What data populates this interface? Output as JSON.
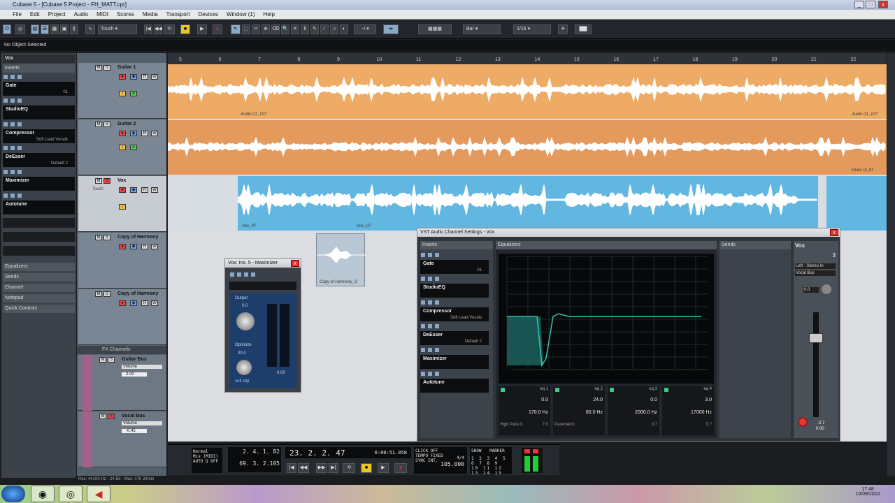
{
  "window": {
    "title": "Cubase 5 - [Cubase 5 Project - FH_MATT.cpr]"
  },
  "menu": [
    "File",
    "Edit",
    "Project",
    "Audio",
    "MIDI",
    "Scores",
    "Media",
    "Transport",
    "Devices",
    "Window (1)",
    "Help"
  ],
  "toolbar": {
    "automation_mode": "Touch",
    "snap_type": "Bar",
    "quantize": "1/16"
  },
  "info_line": "No Object Selected",
  "inspector": {
    "track_name": "Vox",
    "inserts_label": "Inserts",
    "inserts": [
      {
        "name": "Gate",
        "preset": "01"
      },
      {
        "name": "StudioEQ",
        "preset": ""
      },
      {
        "name": "Compressor",
        "preset": "Soft Lead Vocals"
      },
      {
        "name": "DeEsser",
        "preset": "Default 2"
      },
      {
        "name": "Maximizer",
        "preset": ""
      },
      {
        "name": "Autotune",
        "preset": ""
      }
    ],
    "sections": [
      "Equalizers",
      "Sends",
      "Channel",
      "Notepad",
      "Quick Controls"
    ]
  },
  "tracks": [
    {
      "name": "Guitar 1",
      "event": "Audio 01_107",
      "event2": "Audio 01_107"
    },
    {
      "name": "Guitar 2",
      "event": "Guita r2_01"
    },
    {
      "name": "Vox",
      "auto": "Touch",
      "event": "Vox_07",
      "event2": "Vox_07"
    },
    {
      "name": "Copy of Harmony",
      "event": "Copy of Harmony_3"
    },
    {
      "name": "Copy of Harmony"
    }
  ],
  "fx_folder": "FX Channels",
  "fx_tracks": [
    {
      "name": "Guitar Bus",
      "param": "Volume",
      "value": "2.00"
    },
    {
      "name": "Vocal Bus",
      "param": "Volume",
      "value": "-0.45"
    }
  ],
  "ruler": [
    "5",
    "6",
    "7",
    "8",
    "9",
    "10",
    "11",
    "12",
    "13",
    "14",
    "15",
    "16",
    "17",
    "18",
    "19",
    "20",
    "21",
    "22"
  ],
  "maximizer": {
    "title": "Vox: Ins. 5 - Maximizer",
    "output_label": "Output",
    "output_value": "0.0",
    "optimize_label": "Optimize",
    "optimize_value": "20.0",
    "softclip": "soft clip",
    "meter_value": "0.00"
  },
  "channel_settings": {
    "title": "VST Audio Channel Settings - Vox",
    "inserts_label": "Inserts",
    "equalizers_label": "Equalizers",
    "sends_label": "Sends",
    "channel_name": "Vox",
    "channel_number": "3",
    "routing": "Left - Stereo In",
    "output": "Vocal Bus",
    "inserts": [
      {
        "name": "Gate",
        "preset": "01"
      },
      {
        "name": "StudioEQ",
        "preset": ""
      },
      {
        "name": "Compressor",
        "preset": "Soft Lead Vocals"
      },
      {
        "name": "DeEsser",
        "preset": "Default 2"
      },
      {
        "name": "Maximizer",
        "preset": ""
      },
      {
        "name": "Autotune",
        "preset": ""
      }
    ],
    "eq_bands": [
      {
        "label": "eq 1",
        "gain": "0.0",
        "freq": "170.0 Hz",
        "q": "7.0",
        "type": "High Pass II"
      },
      {
        "label": "eq 2",
        "gain": "24.0",
        "freq": "80.0 Hz",
        "q": "",
        "type": "Parametric"
      },
      {
        "label": "eq 3",
        "gain": "0.0",
        "freq": "2000.0 Hz",
        "q": "0.7",
        "type": ""
      },
      {
        "label": "eq 4",
        "gain": "3.0",
        "freq": "17000 Hz",
        "q": "0.7",
        "type": ""
      }
    ],
    "fader_value": "-2.7",
    "pan_value": "0.00",
    "gain_value": "0.0"
  },
  "transport": {
    "left_locator": "2. 4. 1. 82",
    "right_locator": "69. 3. 2.105",
    "position": "23. 2. 2. 47",
    "time": "0:00:51.058",
    "mode1": "Normal",
    "mode2": "Mix (MIDI)",
    "auto_q": "AUTO Q  OFF",
    "click": "CLICK  OFF",
    "tempo_label": "TEMPO  FIXED",
    "sync": "SYNC  INT.",
    "signature": "4/4",
    "tempo": "105.000",
    "show_label": "SHOW",
    "marker_label": "MARKER"
  },
  "status": "Rec: 44100 Hz - 24 Bit - Max: 07h 29min",
  "clock": {
    "time": "17:48",
    "date": "10/09/2010"
  }
}
